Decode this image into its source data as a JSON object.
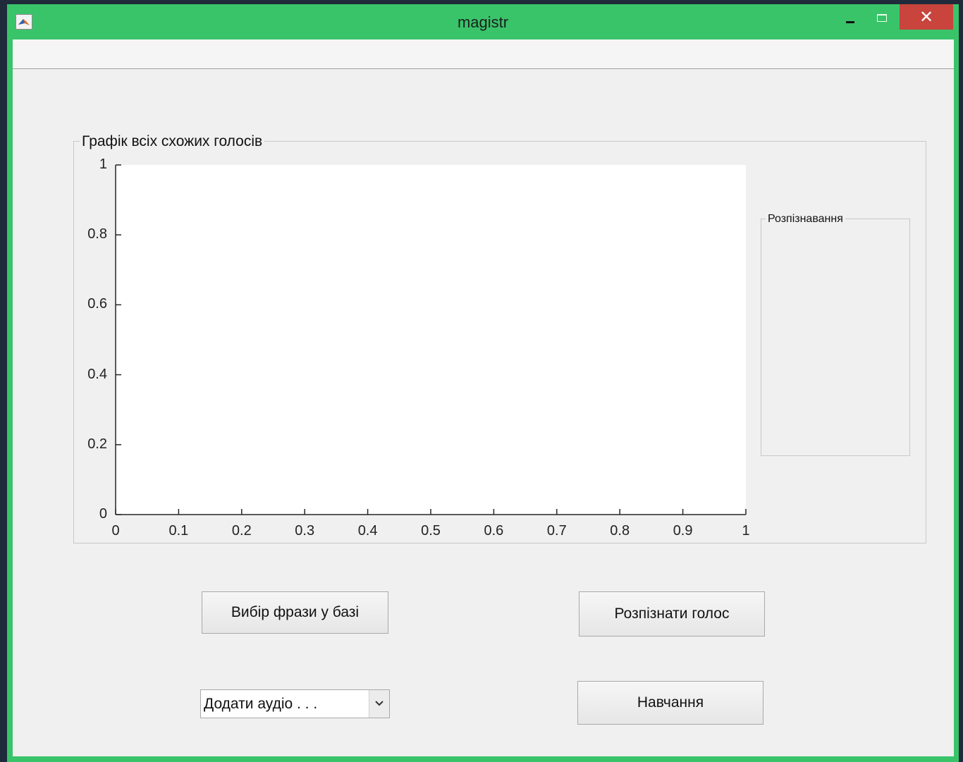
{
  "window": {
    "title": "magistr",
    "app_icon": "matlab-icon",
    "close_glyph": "✕",
    "colors": {
      "frame": "#39c46a",
      "close": "#c8443c",
      "client": "#f0f0f0"
    }
  },
  "plot_panel": {
    "label": "Графік всіх схожих голосів"
  },
  "recognition_panel": {
    "label": "Розпізнавання"
  },
  "chart_data": {
    "type": "line",
    "title": "",
    "xlabel": "",
    "ylabel": "",
    "series": [],
    "xlim": [
      0,
      1
    ],
    "ylim": [
      0,
      1
    ],
    "x_ticks": [
      "0",
      "0.1",
      "0.2",
      "0.3",
      "0.4",
      "0.5",
      "0.6",
      "0.7",
      "0.8",
      "0.9",
      "1"
    ],
    "y_ticks": [
      "0",
      "0.2",
      "0.4",
      "0.6",
      "0.8",
      "1"
    ],
    "grid": false
  },
  "buttons": {
    "choose_phrase": "Вибір фрази у базі",
    "recognize_voice": "Розпізнати голос",
    "training": "Навчання"
  },
  "dropdown": {
    "selected": "Додати аудіо . . ."
  }
}
